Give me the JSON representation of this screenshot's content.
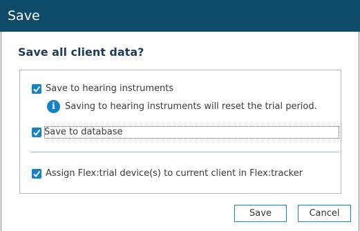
{
  "window": {
    "title": "Save"
  },
  "dialog": {
    "heading": "Save all client data?",
    "options": [
      {
        "label": "Save to hearing instruments",
        "checked": true
      },
      {
        "label": "Save to database",
        "checked": true
      },
      {
        "label": "Assign Flex:trial device(s) to current client in Flex:tracker",
        "checked": true
      }
    ],
    "info_text": "Saving to hearing instruments will reset the trial period.",
    "info_icon": "info-icon"
  },
  "buttons": {
    "save_label": "Save",
    "cancel_label": "Cancel"
  },
  "colors": {
    "titlebar": "#0d4b69",
    "accent": "#1382c6",
    "heading": "#1f3b57"
  }
}
